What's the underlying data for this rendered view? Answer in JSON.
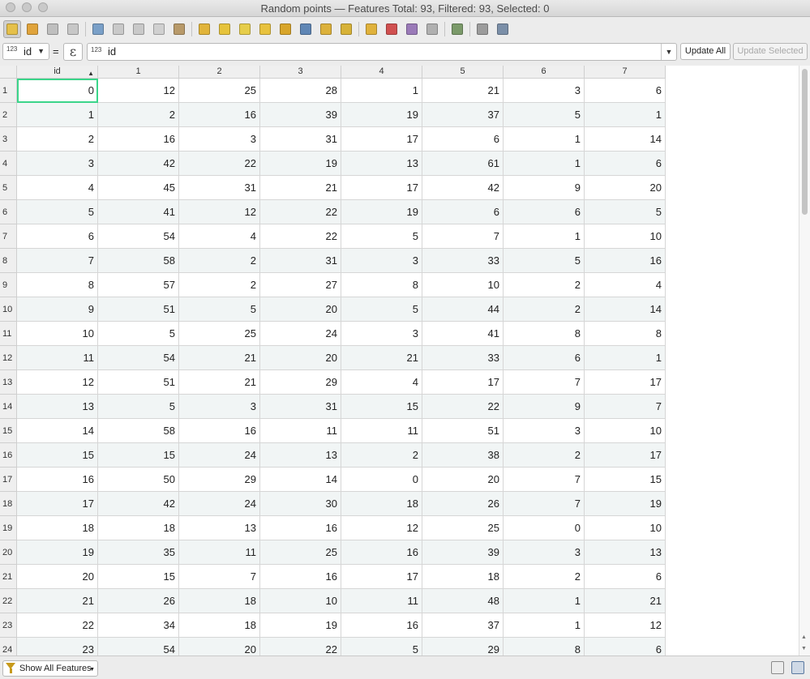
{
  "window": {
    "title": "Random points — Features Total: 93, Filtered: 93, Selected: 0"
  },
  "toolbar": {
    "icons": [
      {
        "name": "toggle-editing-icon",
        "color": "#e5c04a",
        "active": true
      },
      {
        "name": "multi-edit-icon",
        "color": "#e0a43c"
      },
      {
        "name": "save-edits-icon",
        "color": "#bfbfbf"
      },
      {
        "name": "reload-icon",
        "color": "#c7c7c7"
      },
      {
        "sep": true
      },
      {
        "name": "add-feature-icon",
        "color": "#7aa0c8"
      },
      {
        "name": "delete-selected-icon",
        "color": "#c9c9c9"
      },
      {
        "name": "cut-icon",
        "color": "#c9c9c9"
      },
      {
        "name": "copy-icon",
        "color": "#d0d0d0"
      },
      {
        "name": "paste-icon",
        "color": "#b89a6a"
      },
      {
        "sep": true
      },
      {
        "name": "select-by-expression-icon",
        "color": "#e1b43a"
      },
      {
        "name": "select-all-icon",
        "color": "#e6c33b"
      },
      {
        "name": "invert-selection-icon",
        "color": "#e6cd4a"
      },
      {
        "name": "deselect-all-icon",
        "color": "#e8c23e"
      },
      {
        "name": "filter-select-icon",
        "color": "#d8a52a"
      },
      {
        "name": "move-selection-top-icon",
        "color": "#5f86b5"
      },
      {
        "name": "pan-to-selected-icon",
        "color": "#dcb13b"
      },
      {
        "name": "zoom-to-selected-icon",
        "color": "#d7b238"
      },
      {
        "sep": true
      },
      {
        "name": "new-field-icon",
        "color": "#e0b23c"
      },
      {
        "name": "delete-field-icon",
        "color": "#d05050"
      },
      {
        "name": "field-calculator-icon",
        "color": "#9a7ab8"
      },
      {
        "name": "open-field-calculator-icon",
        "color": "#b0b0b0"
      },
      {
        "sep": true
      },
      {
        "name": "conditional-formatting-icon",
        "color": "#7b9a6a"
      },
      {
        "sep": true
      },
      {
        "name": "dock-table-icon",
        "color": "#9c9c9c"
      },
      {
        "name": "actions-icon",
        "color": "#7b8fa8"
      }
    ]
  },
  "expression": {
    "field_type": "123",
    "field_name": "id",
    "equals": "=",
    "epsilon": "ε",
    "input_type": "123",
    "input_value": "id",
    "update_all": "Update All",
    "update_selected": "Update Selected"
  },
  "table": {
    "sort_indicator": "▲",
    "columns": [
      "id",
      "1",
      "2",
      "3",
      "4",
      "5",
      "6",
      "7"
    ],
    "rows": [
      {
        "n": "1",
        "cells": [
          "0",
          "12",
          "25",
          "28",
          "1",
          "21",
          "3",
          "6"
        ]
      },
      {
        "n": "2",
        "cells": [
          "1",
          "2",
          "16",
          "39",
          "19",
          "37",
          "5",
          "1"
        ]
      },
      {
        "n": "3",
        "cells": [
          "2",
          "16",
          "3",
          "31",
          "17",
          "6",
          "1",
          "14"
        ]
      },
      {
        "n": "4",
        "cells": [
          "3",
          "42",
          "22",
          "19",
          "13",
          "61",
          "1",
          "6"
        ]
      },
      {
        "n": "5",
        "cells": [
          "4",
          "45",
          "31",
          "21",
          "17",
          "42",
          "9",
          "20"
        ]
      },
      {
        "n": "6",
        "cells": [
          "5",
          "41",
          "12",
          "22",
          "19",
          "6",
          "6",
          "5"
        ]
      },
      {
        "n": "7",
        "cells": [
          "6",
          "54",
          "4",
          "22",
          "5",
          "7",
          "1",
          "10"
        ]
      },
      {
        "n": "8",
        "cells": [
          "7",
          "58",
          "2",
          "31",
          "3",
          "33",
          "5",
          "16"
        ]
      },
      {
        "n": "9",
        "cells": [
          "8",
          "57",
          "2",
          "27",
          "8",
          "10",
          "2",
          "4"
        ]
      },
      {
        "n": "10",
        "cells": [
          "9",
          "51",
          "5",
          "20",
          "5",
          "44",
          "2",
          "14"
        ]
      },
      {
        "n": "11",
        "cells": [
          "10",
          "5",
          "25",
          "24",
          "3",
          "41",
          "8",
          "8"
        ]
      },
      {
        "n": "12",
        "cells": [
          "11",
          "54",
          "21",
          "20",
          "21",
          "33",
          "6",
          "1"
        ]
      },
      {
        "n": "13",
        "cells": [
          "12",
          "51",
          "21",
          "29",
          "4",
          "17",
          "7",
          "17"
        ]
      },
      {
        "n": "14",
        "cells": [
          "13",
          "5",
          "3",
          "31",
          "15",
          "22",
          "9",
          "7"
        ]
      },
      {
        "n": "15",
        "cells": [
          "14",
          "58",
          "16",
          "11",
          "11",
          "51",
          "3",
          "10"
        ]
      },
      {
        "n": "16",
        "cells": [
          "15",
          "15",
          "24",
          "13",
          "2",
          "38",
          "2",
          "17"
        ]
      },
      {
        "n": "17",
        "cells": [
          "16",
          "50",
          "29",
          "14",
          "0",
          "20",
          "7",
          "15"
        ]
      },
      {
        "n": "18",
        "cells": [
          "17",
          "42",
          "24",
          "30",
          "18",
          "26",
          "7",
          "19"
        ]
      },
      {
        "n": "19",
        "cells": [
          "18",
          "18",
          "13",
          "16",
          "12",
          "25",
          "0",
          "10"
        ]
      },
      {
        "n": "20",
        "cells": [
          "19",
          "35",
          "11",
          "25",
          "16",
          "39",
          "3",
          "13"
        ]
      },
      {
        "n": "21",
        "cells": [
          "20",
          "15",
          "7",
          "16",
          "17",
          "18",
          "2",
          "6"
        ]
      },
      {
        "n": "22",
        "cells": [
          "21",
          "26",
          "18",
          "10",
          "11",
          "48",
          "1",
          "21"
        ]
      },
      {
        "n": "23",
        "cells": [
          "22",
          "34",
          "18",
          "19",
          "16",
          "37",
          "1",
          "12"
        ]
      },
      {
        "n": "24",
        "cells": [
          "23",
          "54",
          "20",
          "22",
          "5",
          "29",
          "8",
          "6"
        ]
      }
    ]
  },
  "status": {
    "show_all": "Show All Features"
  }
}
